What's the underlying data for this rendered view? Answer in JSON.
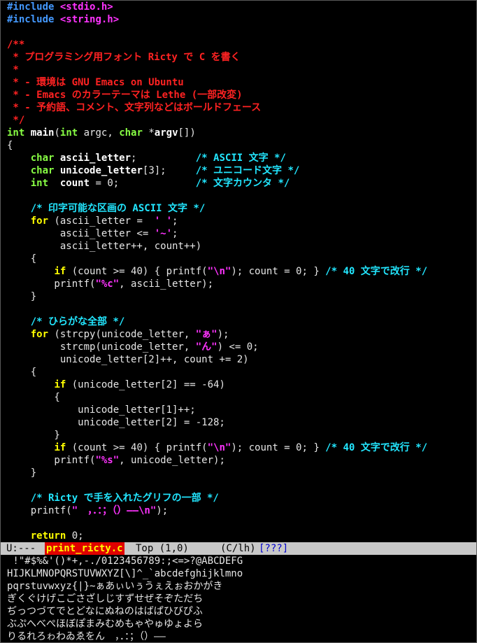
{
  "editor": {
    "lines": [
      [
        {
          "t": "pp",
          "v": "#include"
        },
        {
          "t": "pl",
          "v": " "
        },
        {
          "t": "inc",
          "v": "<stdio.h>"
        }
      ],
      [
        {
          "t": "pp",
          "v": "#include"
        },
        {
          "t": "pl",
          "v": " "
        },
        {
          "t": "inc",
          "v": "<string.h>"
        }
      ],
      [],
      [
        {
          "t": "doc",
          "v": "/**"
        }
      ],
      [
        {
          "t": "doc",
          "v": " * プログラミング用フォント Ricty で C を書く"
        }
      ],
      [
        {
          "t": "doc",
          "v": " *"
        }
      ],
      [
        {
          "t": "doc",
          "v": " * - 環境は GNU Emacs on Ubuntu"
        }
      ],
      [
        {
          "t": "doc",
          "v": " * - Emacs のカラーテーマは Lethe (一部改変)"
        }
      ],
      [
        {
          "t": "doc",
          "v": " * - 予約語、コメント、文字列などはボールドフェース"
        }
      ],
      [
        {
          "t": "doc",
          "v": " */"
        }
      ],
      [
        {
          "t": "ty",
          "v": "int"
        },
        {
          "t": "pl",
          "v": " "
        },
        {
          "t": "fn",
          "v": "main"
        },
        {
          "t": "pl",
          "v": "("
        },
        {
          "t": "ty",
          "v": "int"
        },
        {
          "t": "pl",
          "v": " argc, "
        },
        {
          "t": "ty",
          "v": "char"
        },
        {
          "t": "pl",
          "v": " *"
        },
        {
          "t": "var",
          "v": "argv"
        },
        {
          "t": "pl",
          "v": "[])"
        }
      ],
      [
        {
          "t": "pl",
          "v": "{"
        }
      ],
      [
        {
          "t": "pl",
          "v": "    "
        },
        {
          "t": "ty",
          "v": "char"
        },
        {
          "t": "pl",
          "v": " "
        },
        {
          "t": "var",
          "v": "ascii_letter"
        },
        {
          "t": "pl",
          "v": ";          "
        },
        {
          "t": "cmt",
          "v": "/* ASCII 文字 */"
        }
      ],
      [
        {
          "t": "pl",
          "v": "    "
        },
        {
          "t": "ty",
          "v": "char"
        },
        {
          "t": "pl",
          "v": " "
        },
        {
          "t": "var",
          "v": "unicode_letter"
        },
        {
          "t": "pl",
          "v": "[3];     "
        },
        {
          "t": "cmt",
          "v": "/* ユニコード文字 */"
        }
      ],
      [
        {
          "t": "pl",
          "v": "    "
        },
        {
          "t": "ty",
          "v": "int"
        },
        {
          "t": "pl",
          "v": "  "
        },
        {
          "t": "var",
          "v": "count"
        },
        {
          "t": "pl",
          "v": " = 0;             "
        },
        {
          "t": "cmt",
          "v": "/* 文字カウンタ */"
        }
      ],
      [],
      [
        {
          "t": "pl",
          "v": "    "
        },
        {
          "t": "cmt",
          "v": "/* 印字可能な区画の ASCII 文字 */"
        }
      ],
      [
        {
          "t": "pl",
          "v": "    "
        },
        {
          "t": "kw",
          "v": "for"
        },
        {
          "t": "pl",
          "v": " (ascii_letter =  "
        },
        {
          "t": "str",
          "v": "' '"
        },
        {
          "t": "pl",
          "v": ";"
        }
      ],
      [
        {
          "t": "pl",
          "v": "         ascii_letter <= "
        },
        {
          "t": "str",
          "v": "'~'"
        },
        {
          "t": "pl",
          "v": ";"
        }
      ],
      [
        {
          "t": "pl",
          "v": "         ascii_letter++, count++)"
        }
      ],
      [
        {
          "t": "pl",
          "v": "    {"
        }
      ],
      [
        {
          "t": "pl",
          "v": "        "
        },
        {
          "t": "kw",
          "v": "if"
        },
        {
          "t": "pl",
          "v": " (count >= 40) { printf("
        },
        {
          "t": "str",
          "v": "\"\\n\""
        },
        {
          "t": "pl",
          "v": "); count = 0; } "
        },
        {
          "t": "cmt",
          "v": "/* 40 文字で改行 */"
        }
      ],
      [
        {
          "t": "pl",
          "v": "        printf("
        },
        {
          "t": "str",
          "v": "\"%c\""
        },
        {
          "t": "pl",
          "v": ", ascii_letter);"
        }
      ],
      [
        {
          "t": "pl",
          "v": "    }"
        }
      ],
      [],
      [
        {
          "t": "pl",
          "v": "    "
        },
        {
          "t": "cmt",
          "v": "/* ひらがな全部 */"
        }
      ],
      [
        {
          "t": "pl",
          "v": "    "
        },
        {
          "t": "kw",
          "v": "for"
        },
        {
          "t": "pl",
          "v": " (strcpy(unicode_letter, "
        },
        {
          "t": "str",
          "v": "\"ぁ\""
        },
        {
          "t": "pl",
          "v": ");"
        }
      ],
      [
        {
          "t": "pl",
          "v": "         strcmp(unicode_letter, "
        },
        {
          "t": "str",
          "v": "\"ん\""
        },
        {
          "t": "pl",
          "v": ") <= 0;"
        }
      ],
      [
        {
          "t": "pl",
          "v": "         unicode_letter[2]++, count += 2)"
        }
      ],
      [
        {
          "t": "pl",
          "v": "    {"
        }
      ],
      [
        {
          "t": "pl",
          "v": "        "
        },
        {
          "t": "kw",
          "v": "if"
        },
        {
          "t": "pl",
          "v": " (unicode_letter[2] == -64)"
        }
      ],
      [
        {
          "t": "pl",
          "v": "        {"
        }
      ],
      [
        {
          "t": "pl",
          "v": "            unicode_letter[1]++;"
        }
      ],
      [
        {
          "t": "pl",
          "v": "            unicode_letter[2] = -128;"
        }
      ],
      [
        {
          "t": "pl",
          "v": "        }"
        }
      ],
      [
        {
          "t": "pl",
          "v": "        "
        },
        {
          "t": "kw",
          "v": "if"
        },
        {
          "t": "pl",
          "v": " (count >= 40) { printf("
        },
        {
          "t": "str",
          "v": "\"\\n\""
        },
        {
          "t": "pl",
          "v": "); count = 0; } "
        },
        {
          "t": "cmt",
          "v": "/* 40 文字で改行 */"
        }
      ],
      [
        {
          "t": "pl",
          "v": "        printf("
        },
        {
          "t": "str",
          "v": "\"%s\""
        },
        {
          "t": "pl",
          "v": ", unicode_letter);"
        }
      ],
      [
        {
          "t": "pl",
          "v": "    }"
        }
      ],
      [],
      [
        {
          "t": "pl",
          "v": "    "
        },
        {
          "t": "cmt",
          "v": "/* Ricty で手を入れたグリフの一部 */"
        }
      ],
      [
        {
          "t": "pl",
          "v": "    printf("
        },
        {
          "t": "str",
          "v": "\"　，．：；（）――\\n\""
        },
        {
          "t": "pl",
          "v": ");"
        }
      ],
      [],
      [
        {
          "t": "pl",
          "v": "    "
        },
        {
          "t": "kw",
          "v": "return"
        },
        {
          "t": "pl",
          "v": " 0;"
        }
      ]
    ]
  },
  "modeline": {
    "status": "U:---",
    "buffer": "print_ricty.c",
    "position": "Top (1,0)",
    "mode": "(C/lh)",
    "extra": "[???]",
    "colors": {
      "bg": "#c8c8c8",
      "buffer_bg": "#e00000",
      "buffer_fg": "#ffff00"
    }
  },
  "output": {
    "lines": [
      " !\"#$%&'()*+,-./0123456789:;<=>?@ABCDEFG",
      "HIJKLMNOPQRSTUVWXYZ[\\]^_`abcdefghijklmno",
      "pqrstuvwxyz{|}~ぁあぃいぅうぇえぉおかがき",
      "ぎくぐけげこごさざしじすずせぜそぞただち",
      "ぢっつづてでとどなにぬねのはばぱひびぴふ",
      "ぶぷへべぺほぼぽまみむめもゃやゅゆょよら",
      "りるれろゎわゐゑをん　，．：；（）――"
    ]
  }
}
